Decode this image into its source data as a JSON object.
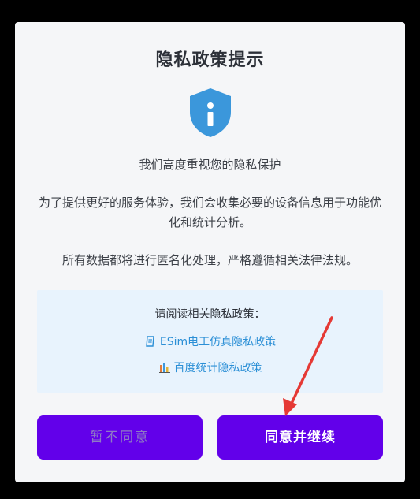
{
  "dialog": {
    "title": "隐私政策提示",
    "shield_icon": "info-shield-icon",
    "subtitle": "我们高度重视您的隐私保护",
    "paragraph1": "为了提供更好的服务体验，我们会收集必要的设备信息用于功能优化和统计分析。",
    "paragraph2": "所有数据都将进行匿名化处理，严格遵循相关法律法规。",
    "policy_box": {
      "title": "请阅读相关隐私政策：",
      "links": [
        {
          "label": "ESim电工仿真隐私政策",
          "icon": "document-icon"
        },
        {
          "label": "百度统计隐私政策",
          "icon": "bar-chart-icon"
        }
      ]
    },
    "buttons": {
      "decline": "暂不同意",
      "accept": "同意并继续"
    }
  },
  "colors": {
    "accent": "#6200ea",
    "link": "#2b8fd6",
    "shield": "#3b97db",
    "annotation_arrow": "#e53935"
  }
}
